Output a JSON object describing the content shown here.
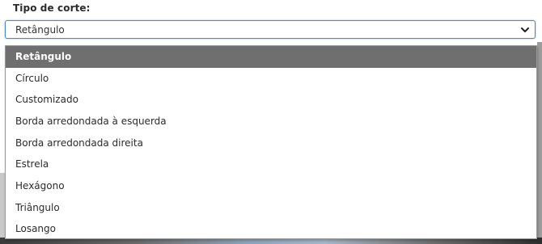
{
  "field": {
    "label": "Tipo de corte:",
    "selected_value": "Retângulo"
  },
  "dropdown": {
    "options": [
      {
        "label": "Retângulo",
        "selected": true
      },
      {
        "label": "Círculo",
        "selected": false
      },
      {
        "label": "Customizado",
        "selected": false
      },
      {
        "label": "Borda arredondada à esquerda",
        "selected": false
      },
      {
        "label": "Borda arredondada direita",
        "selected": false
      },
      {
        "label": "Estrela",
        "selected": false
      },
      {
        "label": "Hexágono",
        "selected": false
      },
      {
        "label": "Triângulo",
        "selected": false
      },
      {
        "label": "Losango",
        "selected": false
      }
    ]
  },
  "icons": {
    "select_arrow": "chevron-down-icon"
  },
  "colors": {
    "focus_border": "#4a86c8",
    "selected_option_bg": "#6f6f6f",
    "selected_option_text": "#ffffff",
    "text": "#2b2b2b"
  }
}
